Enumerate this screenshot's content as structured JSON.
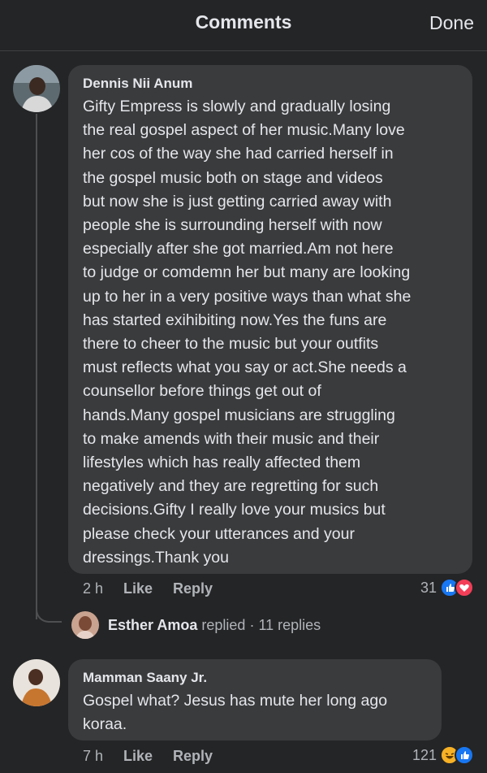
{
  "header": {
    "title": "Comments",
    "done_label": "Done"
  },
  "comments": [
    {
      "author": "Dennis Nii Anum",
      "text": "Gifty Empress is slowly and gradually losing\nthe real gospel aspect of her music.Many love\nher cos of the way she had carried herself in\nthe gospel music both on stage and videos\nbut now she is just getting carried away with\npeople she is surrounding herself with now\nespecially after she got married.Am not here\nto judge or comdemn her but many are looking\nup to her in a very positive ways than what she\nhas started exihibiting now.Yes the funs are\nthere to cheer to the music but your outfits\nmust reflects what you say or act.She needs a\ncounsellor before things get out of\nhands.Many gospel musicians are struggling\nto make amends with their music and their\nlifestyles which has really affected them\nnegatively and they are regretting for such\ndecisions.Gifty I really love your musics but\nplease check your utterances and your\ndressings.Thank you",
      "time": "2 h",
      "like_label": "Like",
      "reply_label": "Reply",
      "reaction_count": "31",
      "reactions": [
        "like-icon",
        "love-icon"
      ],
      "reply_summary": {
        "name": "Esther Amoa",
        "verb": "replied",
        "count": "· 11 replies"
      }
    },
    {
      "author": "Mamman Saany Jr.",
      "text": "Gospel what? Jesus has mute her long ago\nkoraa.",
      "time": "7 h",
      "like_label": "Like",
      "reply_label": "Reply",
      "reaction_count": "121",
      "reactions": [
        "haha-icon",
        "like-icon"
      ]
    }
  ],
  "colors": {
    "background": "#242526",
    "bubble": "#3a3b3c",
    "like": "#1877f2",
    "love": "#f33e58",
    "haha": "#f7b125"
  }
}
